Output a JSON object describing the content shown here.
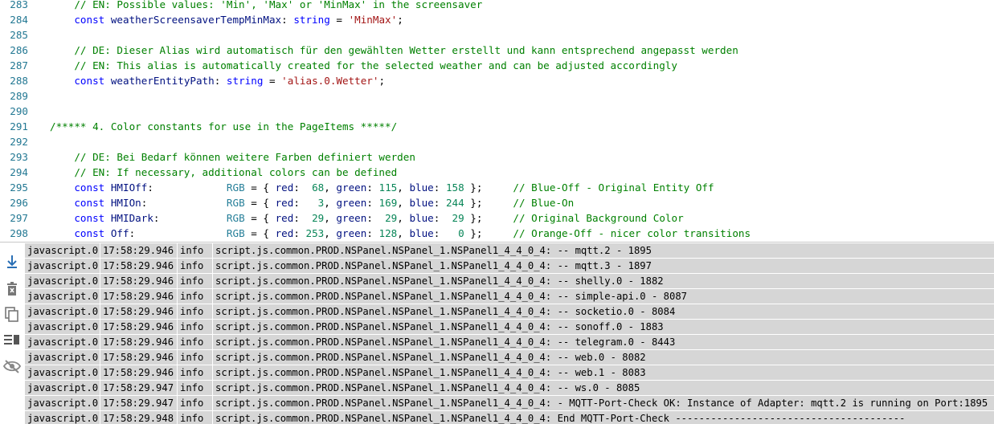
{
  "editor": {
    "lines": [
      {
        "num": "283",
        "tokens": [
          {
            "c": "t-comment",
            "t": "    // EN: Possible values: 'Min', 'Max' or 'MinMax' in the screensaver"
          }
        ]
      },
      {
        "num": "284",
        "tokens": [
          {
            "c": "t-kw",
            "t": "    const "
          },
          {
            "c": "t-var",
            "t": "weatherScreensaverTempMinMax"
          },
          {
            "c": "t-plain",
            "t": ": "
          },
          {
            "c": "t-type",
            "t": "string"
          },
          {
            "c": "t-plain",
            "t": " = "
          },
          {
            "c": "t-str",
            "t": "'MinMax'"
          },
          {
            "c": "t-plain",
            "t": ";"
          }
        ]
      },
      {
        "num": "285",
        "tokens": []
      },
      {
        "num": "286",
        "tokens": [
          {
            "c": "t-comment",
            "t": "    // DE: Dieser Alias wird automatisch für den gewählten Wetter erstellt und kann entsprechend angepasst werden"
          }
        ]
      },
      {
        "num": "287",
        "tokens": [
          {
            "c": "t-comment",
            "t": "    // EN: This alias is automatically created for the selected weather and can be adjusted accordingly"
          }
        ]
      },
      {
        "num": "288",
        "tokens": [
          {
            "c": "t-kw",
            "t": "    const "
          },
          {
            "c": "t-var",
            "t": "weatherEntityPath"
          },
          {
            "c": "t-plain",
            "t": ": "
          },
          {
            "c": "t-type",
            "t": "string"
          },
          {
            "c": "t-plain",
            "t": " = "
          },
          {
            "c": "t-str",
            "t": "'alias.0.Wetter'"
          },
          {
            "c": "t-plain",
            "t": ";"
          }
        ]
      },
      {
        "num": "289",
        "tokens": []
      },
      {
        "num": "290",
        "tokens": []
      },
      {
        "num": "291",
        "tokens": [
          {
            "c": "t-comment",
            "t": "/***** 4. Color constants for use in the PageItems *****/"
          }
        ]
      },
      {
        "num": "292",
        "tokens": []
      },
      {
        "num": "293",
        "tokens": [
          {
            "c": "t-comment",
            "t": "    // DE: Bei Bedarf können weitere Farben definiert werden"
          }
        ]
      },
      {
        "num": "294",
        "tokens": [
          {
            "c": "t-comment",
            "t": "    // EN: If necessary, additional colors can be defined"
          }
        ]
      },
      {
        "num": "295",
        "tokens": [
          {
            "c": "t-kw",
            "t": "    const "
          },
          {
            "c": "t-var",
            "t": "HMIOff"
          },
          {
            "c": "t-plain",
            "t": ":            "
          },
          {
            "c": "t-class",
            "t": "RGB"
          },
          {
            "c": "t-plain",
            "t": " = { "
          },
          {
            "c": "t-var",
            "t": "red"
          },
          {
            "c": "t-plain",
            "t": ":  "
          },
          {
            "c": "t-num",
            "t": "68"
          },
          {
            "c": "t-plain",
            "t": ", "
          },
          {
            "c": "t-var",
            "t": "green"
          },
          {
            "c": "t-plain",
            "t": ": "
          },
          {
            "c": "t-num",
            "t": "115"
          },
          {
            "c": "t-plain",
            "t": ", "
          },
          {
            "c": "t-var",
            "t": "blue"
          },
          {
            "c": "t-plain",
            "t": ": "
          },
          {
            "c": "t-num",
            "t": "158"
          },
          {
            "c": "t-plain",
            "t": " };     "
          },
          {
            "c": "t-comment",
            "t": "// Blue-Off - Original Entity Off"
          }
        ]
      },
      {
        "num": "296",
        "tokens": [
          {
            "c": "t-kw",
            "t": "    const "
          },
          {
            "c": "t-var",
            "t": "HMIOn"
          },
          {
            "c": "t-plain",
            "t": ":             "
          },
          {
            "c": "t-class",
            "t": "RGB"
          },
          {
            "c": "t-plain",
            "t": " = { "
          },
          {
            "c": "t-var",
            "t": "red"
          },
          {
            "c": "t-plain",
            "t": ":   "
          },
          {
            "c": "t-num",
            "t": "3"
          },
          {
            "c": "t-plain",
            "t": ", "
          },
          {
            "c": "t-var",
            "t": "green"
          },
          {
            "c": "t-plain",
            "t": ": "
          },
          {
            "c": "t-num",
            "t": "169"
          },
          {
            "c": "t-plain",
            "t": ", "
          },
          {
            "c": "t-var",
            "t": "blue"
          },
          {
            "c": "t-plain",
            "t": ": "
          },
          {
            "c": "t-num",
            "t": "244"
          },
          {
            "c": "t-plain",
            "t": " };     "
          },
          {
            "c": "t-comment",
            "t": "// Blue-On"
          }
        ]
      },
      {
        "num": "297",
        "tokens": [
          {
            "c": "t-kw",
            "t": "    const "
          },
          {
            "c": "t-var",
            "t": "HMIDark"
          },
          {
            "c": "t-plain",
            "t": ":           "
          },
          {
            "c": "t-class",
            "t": "RGB"
          },
          {
            "c": "t-plain",
            "t": " = { "
          },
          {
            "c": "t-var",
            "t": "red"
          },
          {
            "c": "t-plain",
            "t": ":  "
          },
          {
            "c": "t-num",
            "t": "29"
          },
          {
            "c": "t-plain",
            "t": ", "
          },
          {
            "c": "t-var",
            "t": "green"
          },
          {
            "c": "t-plain",
            "t": ":  "
          },
          {
            "c": "t-num",
            "t": "29"
          },
          {
            "c": "t-plain",
            "t": ", "
          },
          {
            "c": "t-var",
            "t": "blue"
          },
          {
            "c": "t-plain",
            "t": ":  "
          },
          {
            "c": "t-num",
            "t": "29"
          },
          {
            "c": "t-plain",
            "t": " };     "
          },
          {
            "c": "t-comment",
            "t": "// Original Background Color"
          }
        ]
      },
      {
        "num": "298",
        "tokens": [
          {
            "c": "t-kw",
            "t": "    const "
          },
          {
            "c": "t-var",
            "t": "Off"
          },
          {
            "c": "t-plain",
            "t": ":               "
          },
          {
            "c": "t-class",
            "t": "RGB"
          },
          {
            "c": "t-plain",
            "t": " = { "
          },
          {
            "c": "t-var",
            "t": "red"
          },
          {
            "c": "t-plain",
            "t": ": "
          },
          {
            "c": "t-num",
            "t": "253"
          },
          {
            "c": "t-plain",
            "t": ", "
          },
          {
            "c": "t-var",
            "t": "green"
          },
          {
            "c": "t-plain",
            "t": ": "
          },
          {
            "c": "t-num",
            "t": "128"
          },
          {
            "c": "t-plain",
            "t": ", "
          },
          {
            "c": "t-var",
            "t": "blue"
          },
          {
            "c": "t-plain",
            "t": ":   "
          },
          {
            "c": "t-num",
            "t": "0"
          },
          {
            "c": "t-plain",
            "t": " };     "
          },
          {
            "c": "t-comment",
            "t": "// Orange-Off - nicer color transitions"
          }
        ]
      }
    ]
  },
  "log": {
    "toolbar": [
      {
        "name": "scroll-to-bottom-icon"
      },
      {
        "name": "delete-log-icon"
      },
      {
        "name": "copy-icon"
      },
      {
        "name": "list-view-icon"
      },
      {
        "name": "hide-icon"
      }
    ],
    "rows": [
      {
        "src": "javascript.0",
        "time": "17:58:29.946",
        "sev": "info",
        "msg": "script.js.common.PROD.NSPanel.NSPanel_1.NSPanel1_4_4_0_4: -- mqtt.2 - 1895"
      },
      {
        "src": "javascript.0",
        "time": "17:58:29.946",
        "sev": "info",
        "msg": "script.js.common.PROD.NSPanel.NSPanel_1.NSPanel1_4_4_0_4: -- mqtt.3 - 1897"
      },
      {
        "src": "javascript.0",
        "time": "17:58:29.946",
        "sev": "info",
        "msg": "script.js.common.PROD.NSPanel.NSPanel_1.NSPanel1_4_4_0_4: -- shelly.0 - 1882"
      },
      {
        "src": "javascript.0",
        "time": "17:58:29.946",
        "sev": "info",
        "msg": "script.js.common.PROD.NSPanel.NSPanel_1.NSPanel1_4_4_0_4: -- simple-api.0 - 8087"
      },
      {
        "src": "javascript.0",
        "time": "17:58:29.946",
        "sev": "info",
        "msg": "script.js.common.PROD.NSPanel.NSPanel_1.NSPanel1_4_4_0_4: -- socketio.0 - 8084"
      },
      {
        "src": "javascript.0",
        "time": "17:58:29.946",
        "sev": "info",
        "msg": "script.js.common.PROD.NSPanel.NSPanel_1.NSPanel1_4_4_0_4: -- sonoff.0 - 1883"
      },
      {
        "src": "javascript.0",
        "time": "17:58:29.946",
        "sev": "info",
        "msg": "script.js.common.PROD.NSPanel.NSPanel_1.NSPanel1_4_4_0_4: -- telegram.0 - 8443"
      },
      {
        "src": "javascript.0",
        "time": "17:58:29.946",
        "sev": "info",
        "msg": "script.js.common.PROD.NSPanel.NSPanel_1.NSPanel1_4_4_0_4: -- web.0 - 8082"
      },
      {
        "src": "javascript.0",
        "time": "17:58:29.946",
        "sev": "info",
        "msg": "script.js.common.PROD.NSPanel.NSPanel_1.NSPanel1_4_4_0_4: -- web.1 - 8083"
      },
      {
        "src": "javascript.0",
        "time": "17:58:29.947",
        "sev": "info",
        "msg": "script.js.common.PROD.NSPanel.NSPanel_1.NSPanel1_4_4_0_4: -- ws.0 - 8085"
      },
      {
        "src": "javascript.0",
        "time": "17:58:29.947",
        "sev": "info",
        "msg": "script.js.common.PROD.NSPanel.NSPanel_1.NSPanel1_4_4_0_4: - MQTT-Port-Check OK: Instance of Adapter: mqtt.2 is running on Port:1895"
      },
      {
        "src": "javascript.0",
        "time": "17:58:29.948",
        "sev": "info",
        "msg": "script.js.common.PROD.NSPanel.NSPanel_1.NSPanel1_4_4_0_4: End MQTT-Port-Check ---------------------------------------"
      }
    ]
  }
}
